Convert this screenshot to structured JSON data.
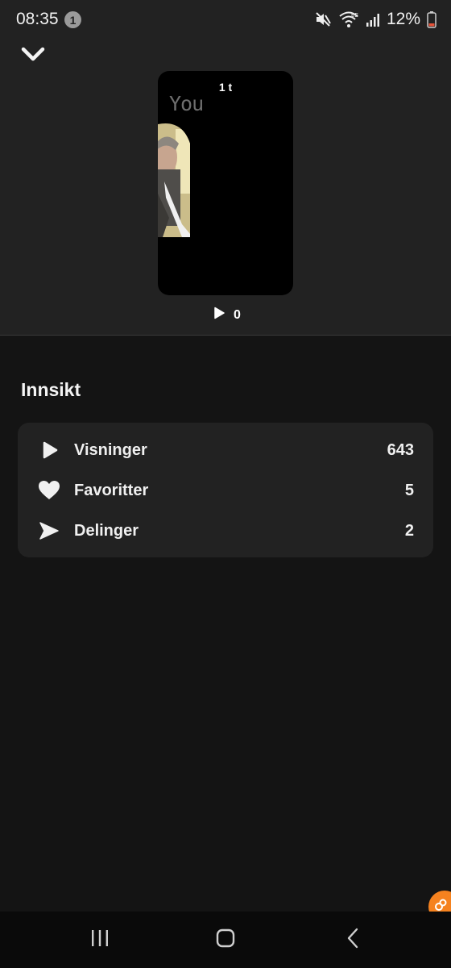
{
  "status_bar": {
    "time": "08:35",
    "notification_count": "1",
    "battery": "12%",
    "icons": [
      "mute-icon",
      "wifi-6e-icon",
      "signal-icon",
      "battery-low-icon"
    ]
  },
  "story": {
    "time_ago": "1 t",
    "overlay_text": "You",
    "views": "0"
  },
  "insights": {
    "title": "Innsikt",
    "stats": [
      {
        "label": "Visninger",
        "value": "643",
        "icon": "play-icon"
      },
      {
        "label": "Favoritter",
        "value": "5",
        "icon": "heart-icon"
      },
      {
        "label": "Delinger",
        "value": "2",
        "icon": "send-icon"
      }
    ]
  },
  "colors": {
    "background": "#141414",
    "surface": "#222222",
    "accent": "#f5821f"
  },
  "nav_bar": {
    "buttons": [
      "recent-apps-icon",
      "home-icon",
      "back-icon"
    ]
  }
}
